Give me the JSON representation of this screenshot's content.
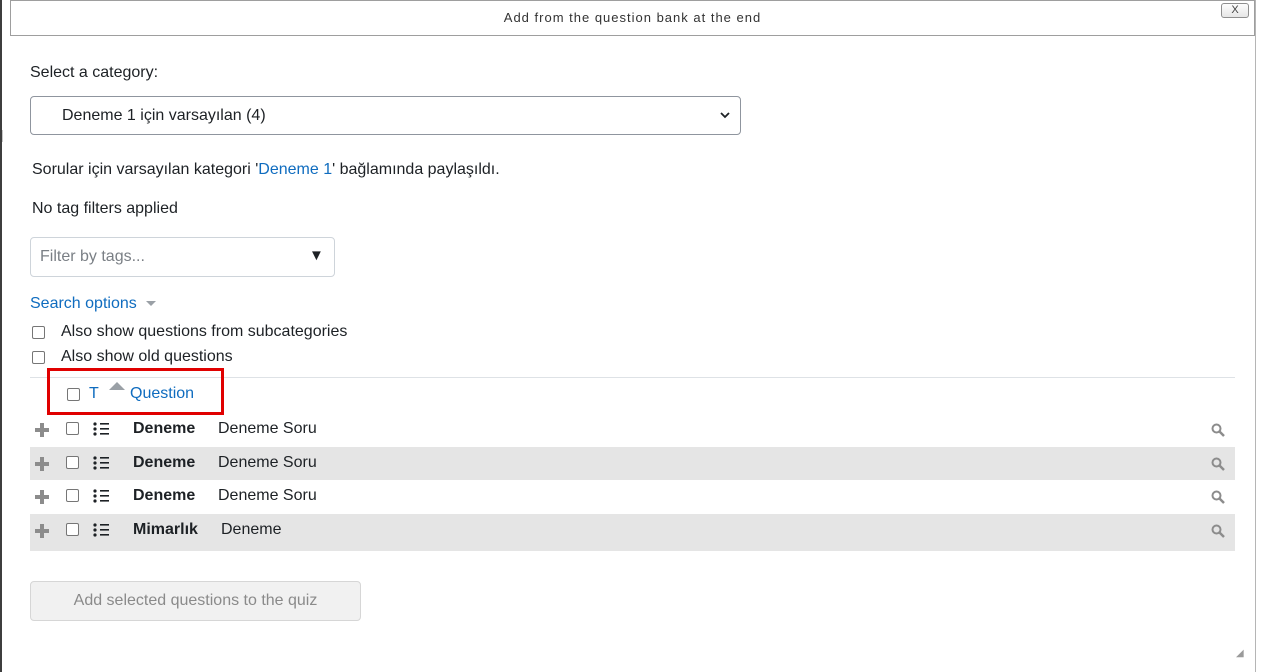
{
  "dialog": {
    "title": "Add from the question bank at the end",
    "close_label": "X"
  },
  "category": {
    "label": "Select a category:",
    "selected": "Deneme 1 için varsayılan (4)"
  },
  "shared_note": {
    "prefix": "Sorular için varsayılan kategori '",
    "link": "Deneme 1",
    "suffix": "' bağlamında paylaşıldı."
  },
  "tags": {
    "status": "No tag filters applied",
    "placeholder": "Filter by tags...",
    "arrow": "▼"
  },
  "search_options": {
    "label": "Search options",
    "subcategories_label": "Also show questions from subcategories",
    "old_questions_label": "Also show old questions"
  },
  "table_header": {
    "type_col": "T",
    "question_col": "Question"
  },
  "questions": [
    {
      "name": "Deneme",
      "text": "Deneme Soru"
    },
    {
      "name": "Deneme",
      "text": "Deneme Soru"
    },
    {
      "name": "Deneme",
      "text": "Deneme Soru"
    },
    {
      "name": "Mimarlık",
      "text": "Deneme"
    }
  ],
  "add_button": "Add selected questions to the quiz",
  "icons": {
    "add": "plus-icon",
    "type": "multichoice-icon",
    "preview": "magnifier-icon",
    "sort": "sort-asc-icon"
  },
  "colors": {
    "link": "#0f6cbf",
    "highlight": "#e00000",
    "row_alt": "#e5e5e5"
  }
}
